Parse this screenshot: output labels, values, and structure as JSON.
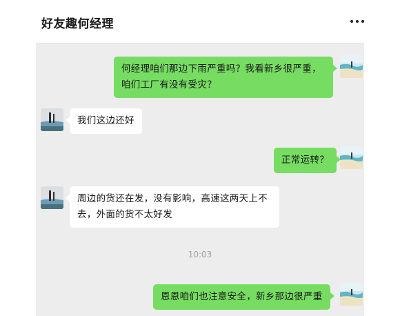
{
  "header": {
    "title": "好友趣何经理",
    "more_icon": "more-dots-icon"
  },
  "messages": [
    {
      "side": "me",
      "text_lines": [
        "何经理咱们那边下雨严重吗？我看新乡很严重，",
        "咱们工厂有没有受灾？"
      ]
    },
    {
      "side": "other",
      "text_lines": [
        "我们这边还好"
      ]
    },
    {
      "side": "me",
      "text_lines": [
        "正常运转？"
      ]
    },
    {
      "side": "other",
      "text_lines": [
        "周边的货还在发，没有影响，高速这两天上不",
        "去，外面的货不太好发"
      ]
    },
    {
      "side": "me",
      "text_lines": [
        "恩恩咱们也注意安全，新乡那边很严重"
      ]
    }
  ],
  "timestamp": "10:03",
  "colors": {
    "my_bubble": "#77dd62",
    "other_bubble": "#ffffff",
    "chat_background": "#ededed"
  },
  "avatars": {
    "me": "beach-photo-avatar",
    "other": "figure-by-water-avatar"
  }
}
